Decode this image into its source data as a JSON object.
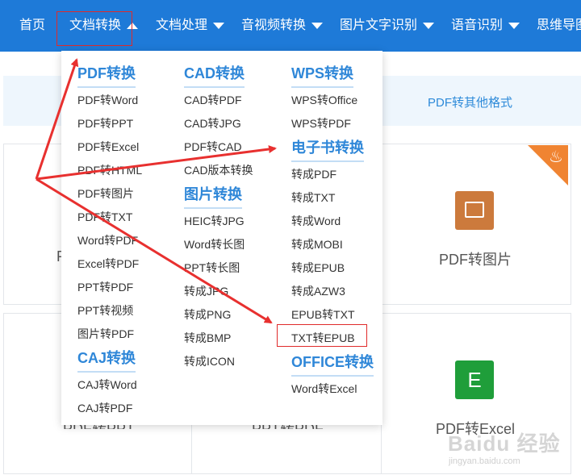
{
  "nav": {
    "items": [
      {
        "label": "首页"
      },
      {
        "label": "文档转换"
      },
      {
        "label": "文档处理"
      },
      {
        "label": "音视频转换"
      },
      {
        "label": "图片文字识别"
      },
      {
        "label": "语音识别"
      },
      {
        "label": "思维导图"
      }
    ]
  },
  "subbar": {
    "link": "PDF转其他格式"
  },
  "cards": {
    "pdf_to_image": "PDF转图片",
    "pdf_to_excel": "PDF转Excel",
    "pdf_to_ppt": "PDF转PPT",
    "ppt_to_pdf": "PPT转PDF",
    "partial_left": "P",
    "excel_tile_letter": "E"
  },
  "dropdown": {
    "pdf": {
      "title": "PDF转换",
      "items": [
        "PDF转Word",
        "PDF转PPT",
        "PDF转Excel",
        "PDF转HTML",
        "PDF转图片",
        "PDF转TXT",
        "Word转PDF",
        "Excel转PDF",
        "PPT转PDF",
        "PPT转视频",
        "图片转PDF"
      ]
    },
    "caj": {
      "title": "CAJ转换",
      "items": [
        "CAJ转Word",
        "CAJ转PDF"
      ]
    },
    "cad": {
      "title": "CAD转换",
      "items": [
        "CAD转PDF",
        "CAD转JPG",
        "PDF转CAD",
        "CAD版本转换"
      ]
    },
    "image": {
      "title": "图片转换",
      "items": [
        "HEIC转JPG",
        "Word转长图",
        "PPT转长图",
        "转成JPG",
        "转成PNG",
        "转成BMP",
        "转成ICON"
      ]
    },
    "wps": {
      "title": "WPS转换",
      "items": [
        "WPS转Office",
        "WPS转PDF"
      ]
    },
    "ebook": {
      "title": "电子书转换",
      "items": [
        "转成PDF",
        "转成TXT",
        "转成Word",
        "转成MOBI",
        "转成EPUB",
        "转成AZW3",
        "EPUB转TXT",
        "TXT转EPUB"
      ]
    },
    "office": {
      "title": "OFFICE转换",
      "items": [
        "Word转Excel"
      ]
    }
  },
  "watermark": {
    "brand": "Baidu 经验",
    "url": "jingyan.baidu.com"
  },
  "colors": {
    "nav_bg": "#1e7ad8",
    "accent": "#2f87d8",
    "highlight": "#e02a2a"
  }
}
